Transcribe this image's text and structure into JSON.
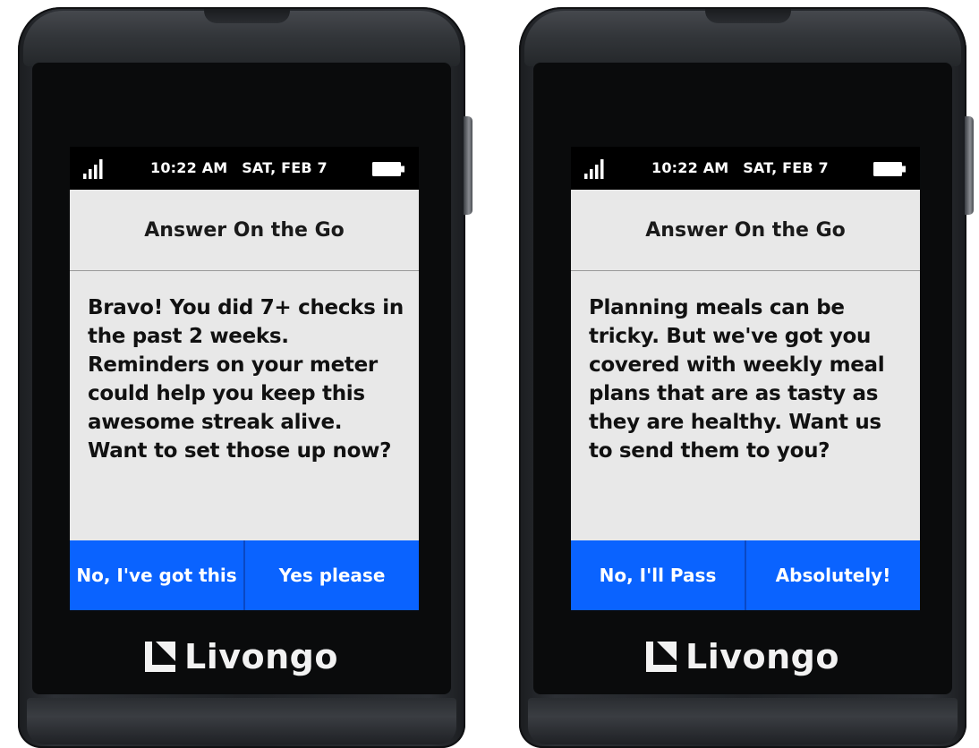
{
  "devices": [
    {
      "status": {
        "time": "10:22 AM",
        "date": "SAT, FEB 7"
      },
      "title": "Answer On the Go",
      "message": "Bravo! You did 7+ checks in the past 2 weeks. Reminders on your meter could help you keep this awesome streak alive. Want to set those up now?",
      "buttons": {
        "secondary": "No, I've got this",
        "primary": "Yes please"
      },
      "brand": "Livongo"
    },
    {
      "status": {
        "time": "10:22 AM",
        "date": "SAT, FEB 7"
      },
      "title": "Answer On the Go",
      "message": "Planning meals can be tricky. But we've got you covered with weekly meal plans that are as tasty as they are healthy. Want us to send them to you?",
      "buttons": {
        "secondary": "No, I'll Pass",
        "primary": "Absolutely!"
      },
      "brand": "Livongo"
    }
  ],
  "colors": {
    "action_blue": "#0a63ff",
    "screen_background": "#e8e8e8",
    "status_bar": "#000000"
  },
  "icons": [
    "signal-icon",
    "battery-icon",
    "livongo-logo-icon"
  ]
}
